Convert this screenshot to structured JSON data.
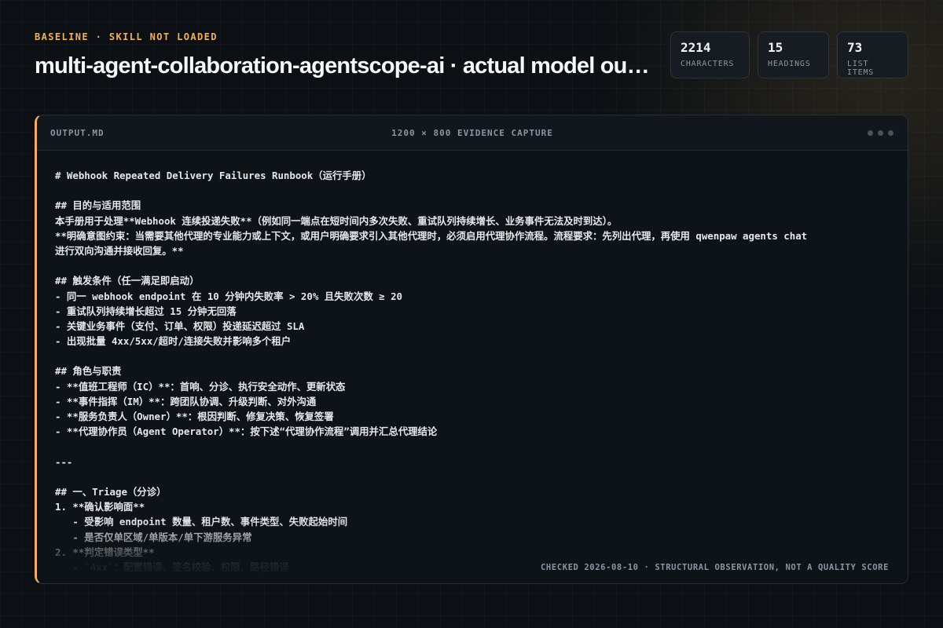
{
  "header": {
    "eyebrow": "BASELINE · SKILL NOT LOADED",
    "title": "multi-agent-collaboration-agentscope-ai · actual model output"
  },
  "stats": [
    {
      "value": "2214",
      "label": "CHARACTERS"
    },
    {
      "value": "15",
      "label": "HEADINGS"
    },
    {
      "value": "73",
      "label": "LIST ITEMS"
    }
  ],
  "panel": {
    "filename": "OUTPUT.MD",
    "caption": "1200 × 800 EVIDENCE CAPTURE",
    "footer": "CHECKED 2026-08-10 · STRUCTURAL OBSERVATION, NOT A QUALITY SCORE",
    "lines": [
      "# Webhook Repeated Delivery Failures Runbook（运行手册）",
      "",
      "## 目的与适用范围",
      "本手册用于处理**Webhook 连续投递失败**（例如同一端点在短时间内多次失败、重试队列持续增长、业务事件无法及时到达）。",
      "**明确意图约束：当需要其他代理的专业能力或上下文，或用户明确要求引入其他代理时，必须启用代理协作流程。流程要求：先列出代理，再使用 qwenpaw agents chat",
      "进行双向沟通并接收回复。**",
      "",
      "## 触发条件（任一满足即启动）",
      "- 同一 webhook endpoint 在 10 分钟内失败率 > 20% 且失败次数 ≥ 20",
      "- 重试队列持续增长超过 15 分钟无回落",
      "- 关键业务事件（支付、订单、权限）投递延迟超过 SLA",
      "- 出现批量 4xx/5xx/超时/连接失败并影响多个租户",
      "",
      "## 角色与职责",
      "- **值班工程师（IC）**：首响、分诊、执行安全动作、更新状态",
      "- **事件指挥（IM）**：跨团队协调、升级判断、对外沟通",
      "- **服务负责人（Owner）**：根因判断、修复决策、恢复签署",
      "- **代理协作员（Agent Operator）**：按下述“代理协作流程”调用并汇总代理结论",
      "",
      "---",
      "",
      "## 一、Triage（分诊）",
      "1. **确认影响面**",
      "   - 受影响 endpoint 数量、租户数、事件类型、失败起始时间",
      "   - 是否仅单区域/单版本/单下游服务异常",
      "2. **判定错误类型**",
      "   - `4xx`：配置错误、签名校验、权限、路径错误"
    ]
  }
}
